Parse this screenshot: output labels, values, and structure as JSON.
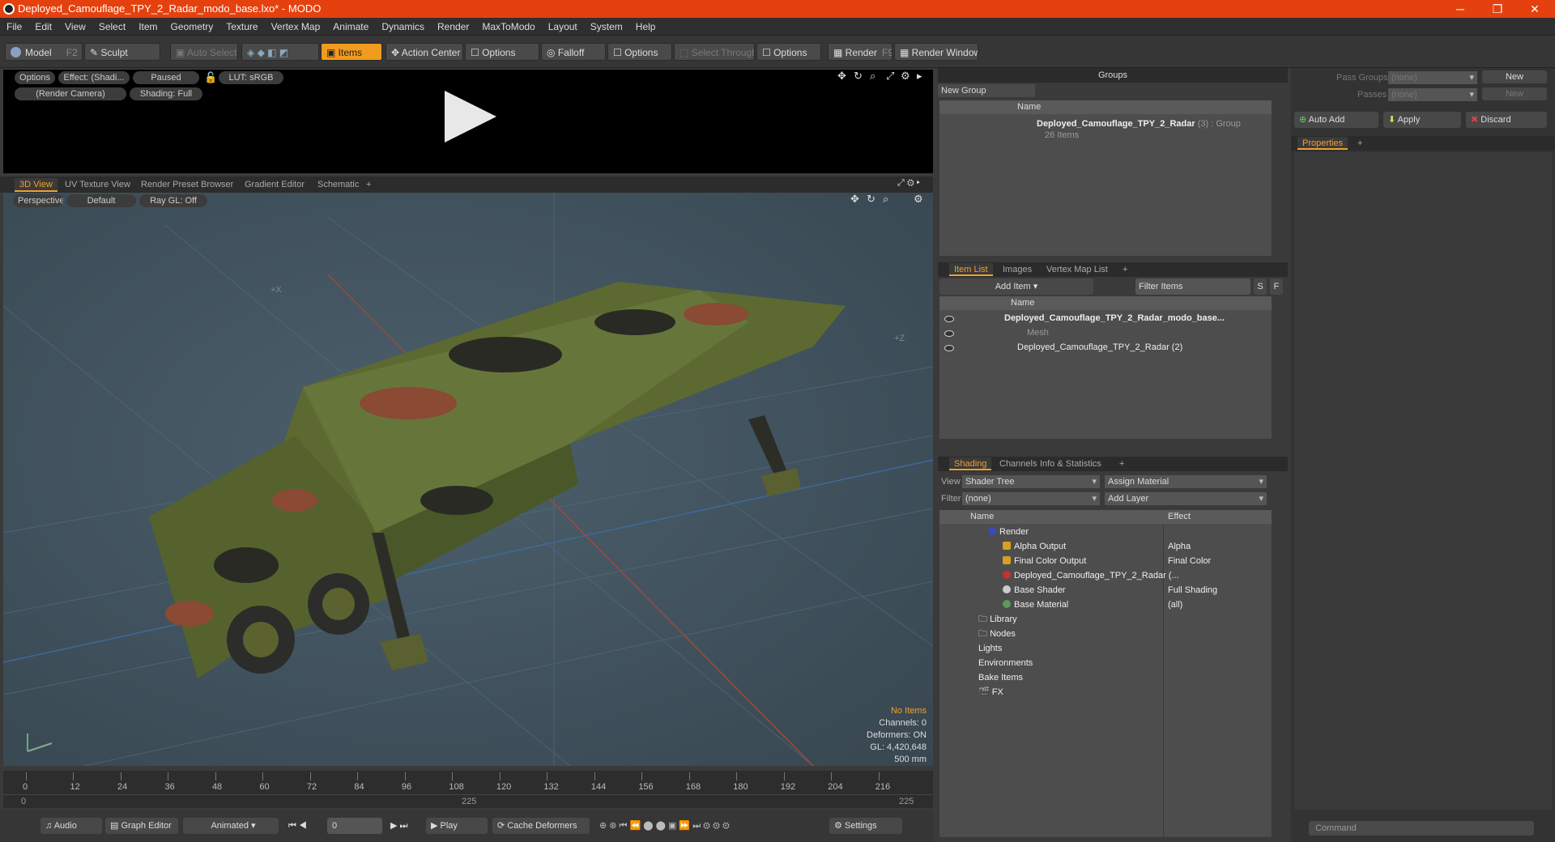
{
  "window": {
    "title": "Deployed_Camouflage_TPY_2_Radar_modo_base.lxo* - MODO",
    "controls": [
      "─",
      "❐",
      "✕"
    ]
  },
  "menu": [
    "File",
    "Edit",
    "View",
    "Select",
    "Item",
    "Geometry",
    "Texture",
    "Vertex Map",
    "Animate",
    "Dynamics",
    "Render",
    "MaxToModo",
    "Layout",
    "System",
    "Help"
  ],
  "toolbar": {
    "model": "Model",
    "model_key": "F2",
    "sculpt": "Sculpt",
    "auto_select": "Auto Select",
    "items": "Items",
    "action_center": "Action Center",
    "options1": "Options",
    "falloff": "Falloff",
    "options2": "Options",
    "select_through": "Select Through",
    "options3": "Options",
    "render": "Render",
    "render_key": "F9",
    "render_window": "Render Window"
  },
  "render_preview": {
    "options": "Options",
    "effect": "Effect: (Shadi...",
    "paused": "Paused",
    "lut": "LUT: sRGB",
    "camera": "(Render Camera)",
    "shading": "Shading: Full"
  },
  "viewport_tabs": [
    "3D View",
    "UV Texture View",
    "Render Preset Browser",
    "Gradient Editor",
    "Schematic",
    "+"
  ],
  "viewport": {
    "perspective": "Perspective",
    "default": "Default",
    "raygl": "Ray GL: Off",
    "axis_x": "+X",
    "axis_z": "+Z",
    "info": {
      "items": "No Items",
      "channels": "Channels: 0",
      "deformers": "Deformers: ON",
      "gl": "GL: 4,420,648",
      "scale": "500 mm"
    }
  },
  "timeline": {
    "ticks": [
      "0",
      "12",
      "24",
      "36",
      "48",
      "60",
      "72",
      "84",
      "96",
      "108",
      "120",
      "132",
      "144",
      "156",
      "168",
      "180",
      "192",
      "204",
      "216"
    ],
    "start": "0",
    "mid": "225",
    "end": "225"
  },
  "bottom": {
    "audio": "Audio",
    "graph_editor": "Graph Editor",
    "animated": "Animated",
    "frame": "0",
    "play": "Play",
    "cache": "Cache Deformers",
    "settings": "Settings"
  },
  "groups": {
    "title": "Groups",
    "new_group": "New Group",
    "col_name": "Name",
    "item_name": "Deployed_Camouflage_TPY_2_Radar",
    "item_suffix": "(3) : Group",
    "item_count": "26 Items"
  },
  "item_list": {
    "tabs": [
      "Item List",
      "Images",
      "Vertex Map List",
      "+"
    ],
    "add_item": "Add Item",
    "filter": "Filter Items",
    "s": "S",
    "f": "F",
    "col_name": "Name",
    "rows": [
      "Deployed_Camouflage_TPY_2_Radar_modo_base...",
      "Mesh",
      "Deployed_Camouflage_TPY_2_Radar (2)"
    ]
  },
  "shading": {
    "tabs": [
      "Shading",
      "Channels",
      "Info & Statistics",
      "+"
    ],
    "view_label": "View",
    "view_value": "Shader Tree",
    "assign_material": "Assign Material",
    "filter_label": "Filter",
    "filter_value": "(none)",
    "add_layer": "Add Layer",
    "col_name": "Name",
    "col_effect": "Effect",
    "rows": [
      {
        "name": "Render",
        "effect": ""
      },
      {
        "name": "Alpha Output",
        "effect": "Alpha"
      },
      {
        "name": "Final Color Output",
        "effect": "Final Color"
      },
      {
        "name": "Deployed_Camouflage_TPY_2_Radar (...",
        "effect": ""
      },
      {
        "name": "Base Shader",
        "effect": "Full Shading"
      },
      {
        "name": "Base Material",
        "effect": "(all)"
      },
      {
        "name": "Library",
        "effect": ""
      },
      {
        "name": "Nodes",
        "effect": ""
      },
      {
        "name": "Lights",
        "effect": ""
      },
      {
        "name": "Environments",
        "effect": ""
      },
      {
        "name": "Bake Items",
        "effect": ""
      },
      {
        "name": "FX",
        "effect": ""
      }
    ]
  },
  "right": {
    "pass_groups": "Pass Groups",
    "passes": "Passes",
    "none1": "(none)",
    "none2": "(none)",
    "new1": "New",
    "new2": "New",
    "auto_add": "Auto Add",
    "apply": "Apply",
    "discard": "Discard",
    "properties": "Properties",
    "plus": "+",
    "command": "Command"
  },
  "colors": {
    "accent": "#f0a030",
    "title": "#e5410e"
  }
}
